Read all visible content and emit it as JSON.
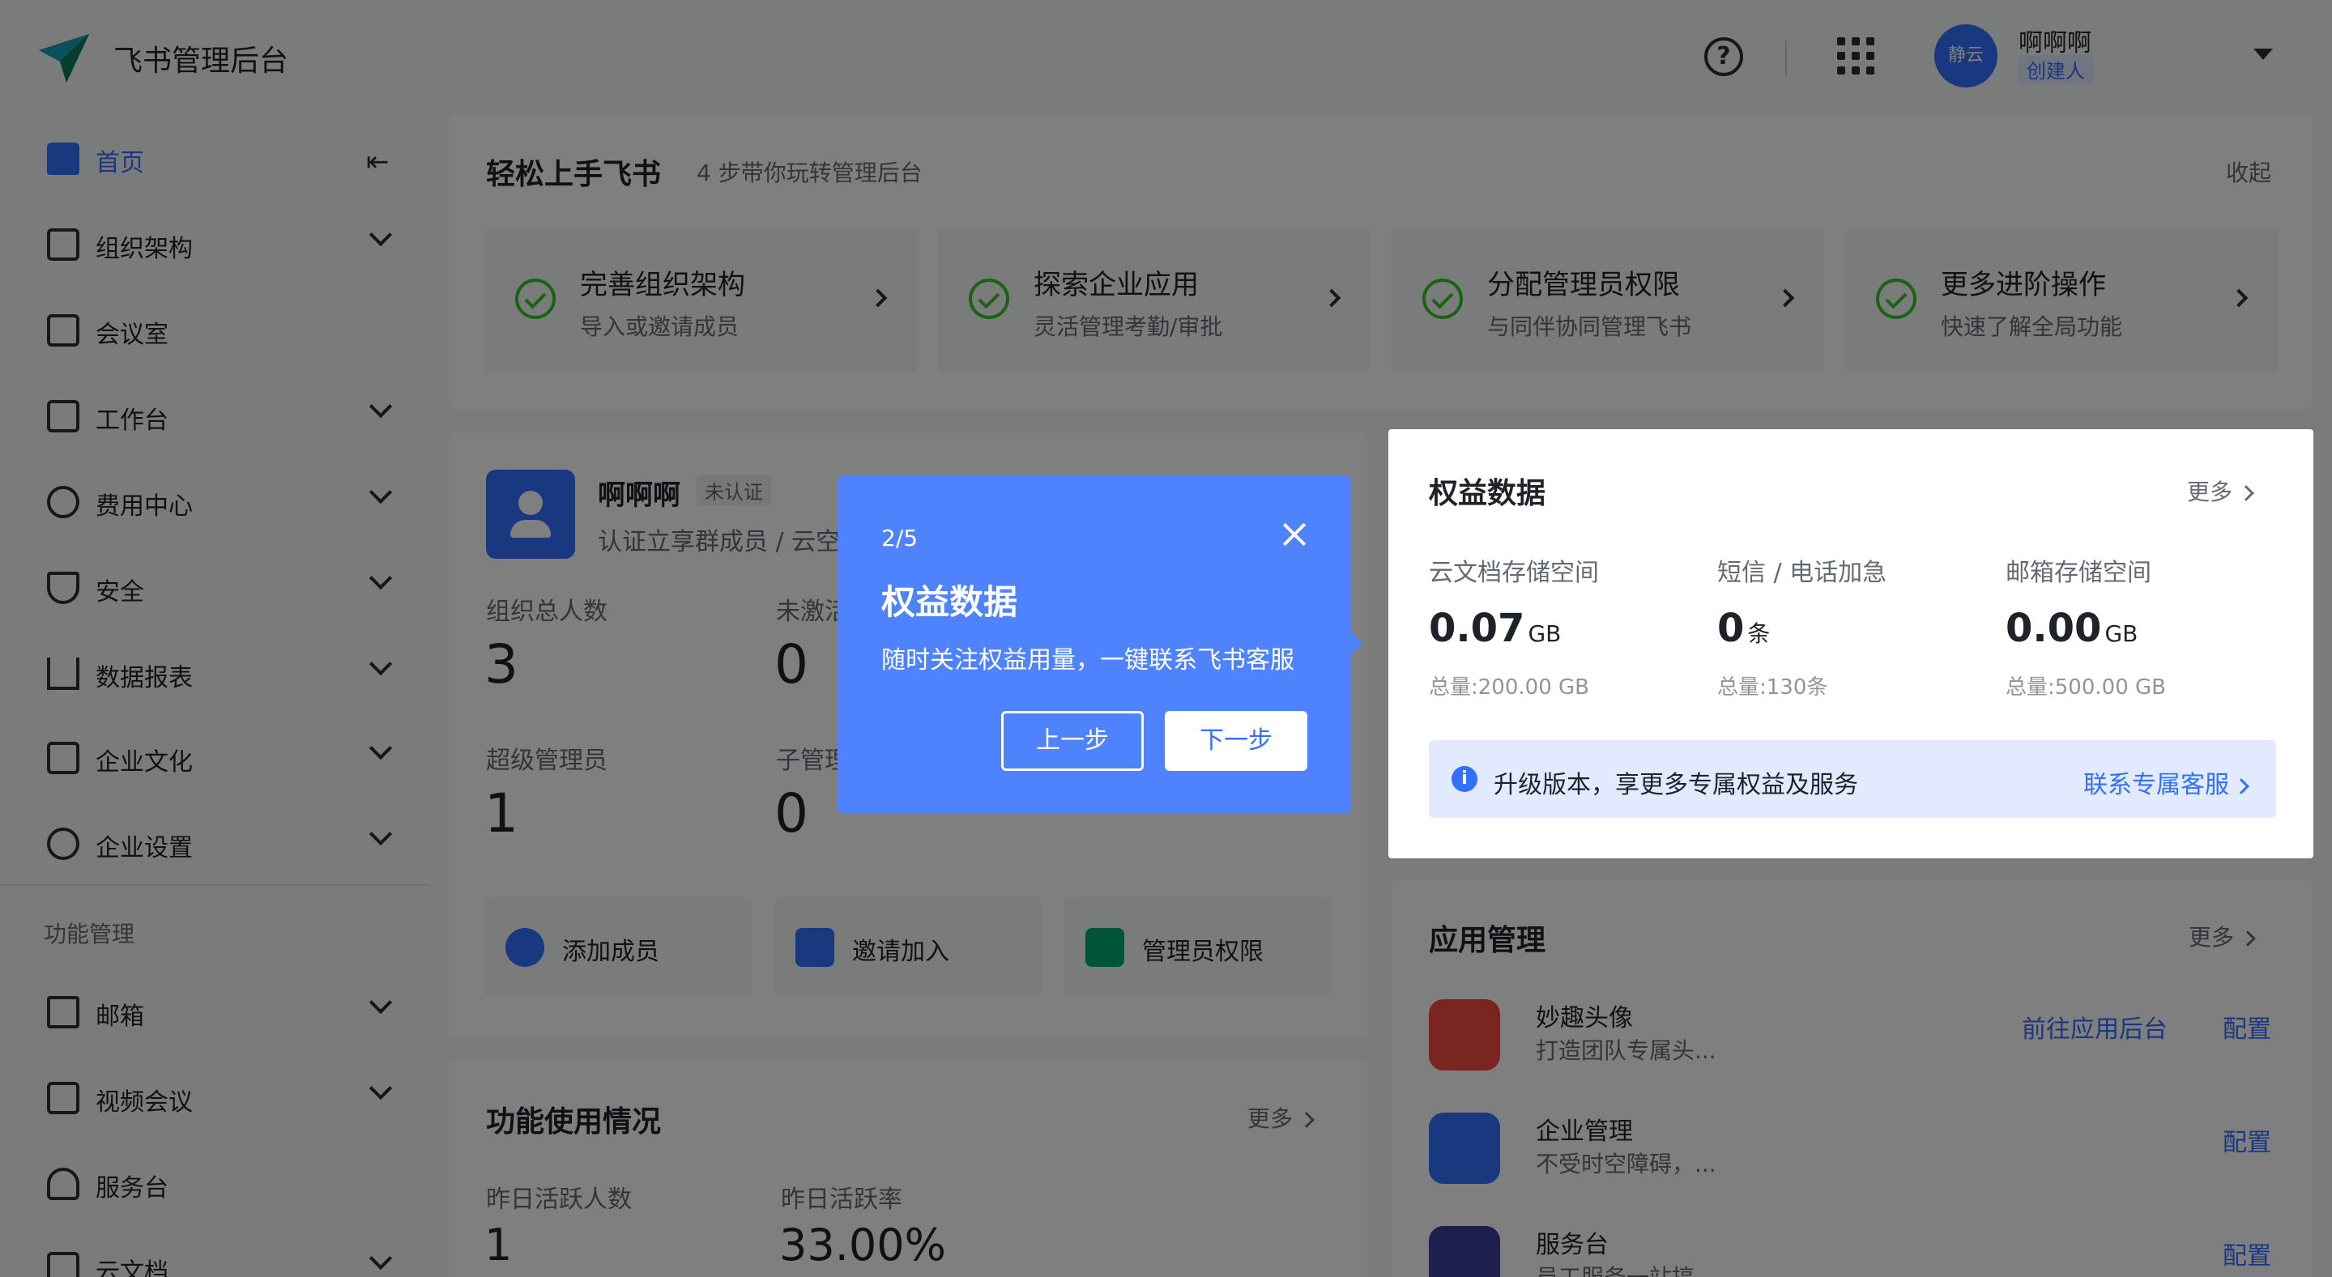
{
  "header": {
    "app_title": "飞书管理后台",
    "avatar_text": "静云",
    "user_name": "啊啊啊",
    "user_role": "创建人"
  },
  "sidebar": {
    "items": [
      {
        "label": "首页",
        "icon": "home-icon",
        "active": true
      },
      {
        "label": "组织架构",
        "icon": "org-icon"
      },
      {
        "label": "会议室",
        "icon": "meeting-room-icon"
      },
      {
        "label": "工作台",
        "icon": "workbench-icon"
      },
      {
        "label": "费用中心",
        "icon": "dollar-icon"
      },
      {
        "label": "安全",
        "icon": "shield-icon"
      },
      {
        "label": "数据报表",
        "icon": "bar-chart-icon"
      },
      {
        "label": "企业文化",
        "icon": "culture-icon"
      },
      {
        "label": "企业设置",
        "icon": "settings-icon"
      }
    ],
    "section_label": "功能管理",
    "section_items": [
      {
        "label": "邮箱",
        "icon": "mail-icon"
      },
      {
        "label": "视频会议",
        "icon": "video-icon"
      },
      {
        "label": "服务台",
        "icon": "headset-icon"
      },
      {
        "label": "云文档",
        "icon": "doc-icon"
      }
    ]
  },
  "getting_started": {
    "title": "轻松上手飞书",
    "subtitle": "4 步带你玩转管理后台",
    "collapse": "收起",
    "steps": [
      {
        "title": "完善组织架构",
        "desc": "导入或邀请成员"
      },
      {
        "title": "探索企业应用",
        "desc": "灵活管理考勤/审批"
      },
      {
        "title": "分配管理员权限",
        "desc": "与同伴协同管理飞书"
      },
      {
        "title": "更多进阶操作",
        "desc": "快速了解全局功能"
      }
    ]
  },
  "org": {
    "name": "啊啊啊",
    "badge": "未认证",
    "tip": "认证立享群成员 / 云空",
    "stats": [
      {
        "label": "组织总人数",
        "value": "3"
      },
      {
        "label": "未激活",
        "value": "0"
      },
      {
        "label": "超级管理员",
        "value": "1"
      },
      {
        "label": "子管理",
        "value": "0"
      }
    ],
    "actions": [
      {
        "label": "添加成员"
      },
      {
        "label": "邀请加入"
      },
      {
        "label": "管理员权限"
      }
    ]
  },
  "usage": {
    "title": "功能使用情况",
    "more": "更多",
    "stats": [
      {
        "label": "昨日活跃人数",
        "value": "1"
      },
      {
        "label": "昨日活跃率",
        "value": "33.00%"
      }
    ]
  },
  "benefit": {
    "title": "权益数据",
    "more": "更多",
    "cols": [
      {
        "label": "云文档存储空间",
        "value": "0.07",
        "unit": "GB",
        "total": "总量:200.00 GB"
      },
      {
        "label": "短信 / 电话加急",
        "value": "0",
        "unit": "条",
        "total": "总量:130条"
      },
      {
        "label": "邮箱存储空间",
        "value": "0.00",
        "unit": "GB",
        "total": "总量:500.00 GB"
      }
    ],
    "banner_text": "升级版本，享更多专属权益及服务",
    "banner_link": "联系专属客服"
  },
  "apps": {
    "title": "应用管理",
    "more": "更多",
    "items": [
      {
        "name": "妙趣头像",
        "desc": "打造团队专属头...",
        "link": "前往应用后台",
        "config": "配置",
        "color": "#f54a45"
      },
      {
        "name": "企业管理",
        "desc": "不受时空障碍，...",
        "config": "配置",
        "color": "#3370ff"
      },
      {
        "name": "服务台",
        "desc": "员工服务一站搞",
        "config": "配置",
        "color": "#3c3c9e"
      }
    ]
  },
  "tour": {
    "step": "2/5",
    "title": "权益数据",
    "desc": "随时关注权益用量，一键联系飞书客服",
    "prev": "上一步",
    "next": "下一步"
  }
}
